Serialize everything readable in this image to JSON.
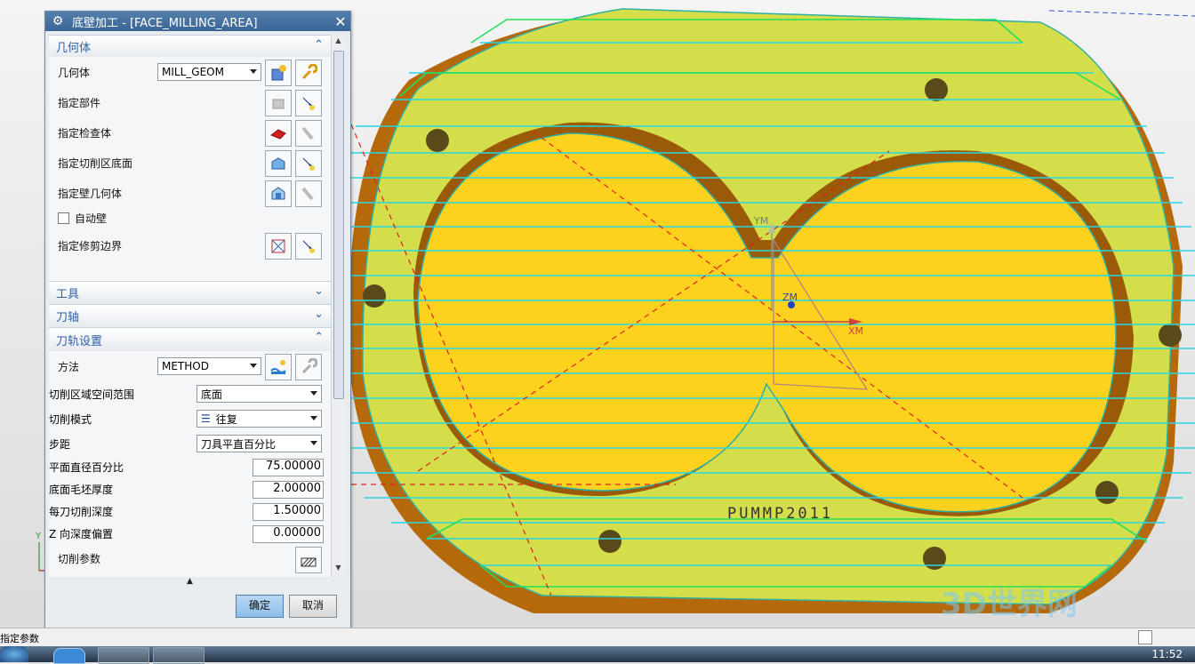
{
  "dialog": {
    "title": "底壁加工 - [FACE_MILLING_AREA]",
    "sections": {
      "geometry": "几何体",
      "tool": "工具",
      "axis": "刀轴",
      "path_settings": "刀轨设置"
    },
    "geometry": {
      "geometry_label": "几何体",
      "geometry_value": "MILL_GEOM",
      "specify_part": "指定部件",
      "specify_check": "指定检查体",
      "specify_floor": "指定切削区底面",
      "specify_wall": "指定壁几何体",
      "auto_wall": "自动壁",
      "specify_trim": "指定修剪边界"
    },
    "path": {
      "method_label": "方法",
      "method_value": "METHOD",
      "cut_range_label": "切削区域空间范围",
      "cut_range_value": "底面",
      "cut_pattern_label": "切削模式",
      "cut_pattern_value": "往复",
      "stepover_label": "步距",
      "stepover_value": "刀具平直百分比",
      "flat_pct_label": "平面直径百分比",
      "flat_pct_value": "75.00000",
      "floor_stock_label": "底面毛坯厚度",
      "floor_stock_value": "2.00000",
      "depth_per_cut_label": "每刀切削深度",
      "depth_per_cut_value": "1.50000",
      "z_offset_label": "Z 向深度偏置",
      "z_offset_value": "0.00000",
      "cut_params_label": "切削参数"
    },
    "ok": "确定",
    "cancel": "取消"
  },
  "viewport": {
    "part_label": "PUMMP2011",
    "axis_x": "XM",
    "axis_y": "YM",
    "axis_z": "ZM",
    "corner_axis_y": "Y"
  },
  "status": {
    "text": "指定参数"
  },
  "taskbar": {
    "clock": "11:52"
  },
  "watermark": "3D世界网",
  "colors": {
    "part_face": "#d4dd4a",
    "pocket_floor": "#fdd21f",
    "wall": "#b86a06",
    "toolpath": "#27d6e3",
    "toolpath_edge": "#20e05a",
    "dialog_title": "#3f6b9d"
  }
}
